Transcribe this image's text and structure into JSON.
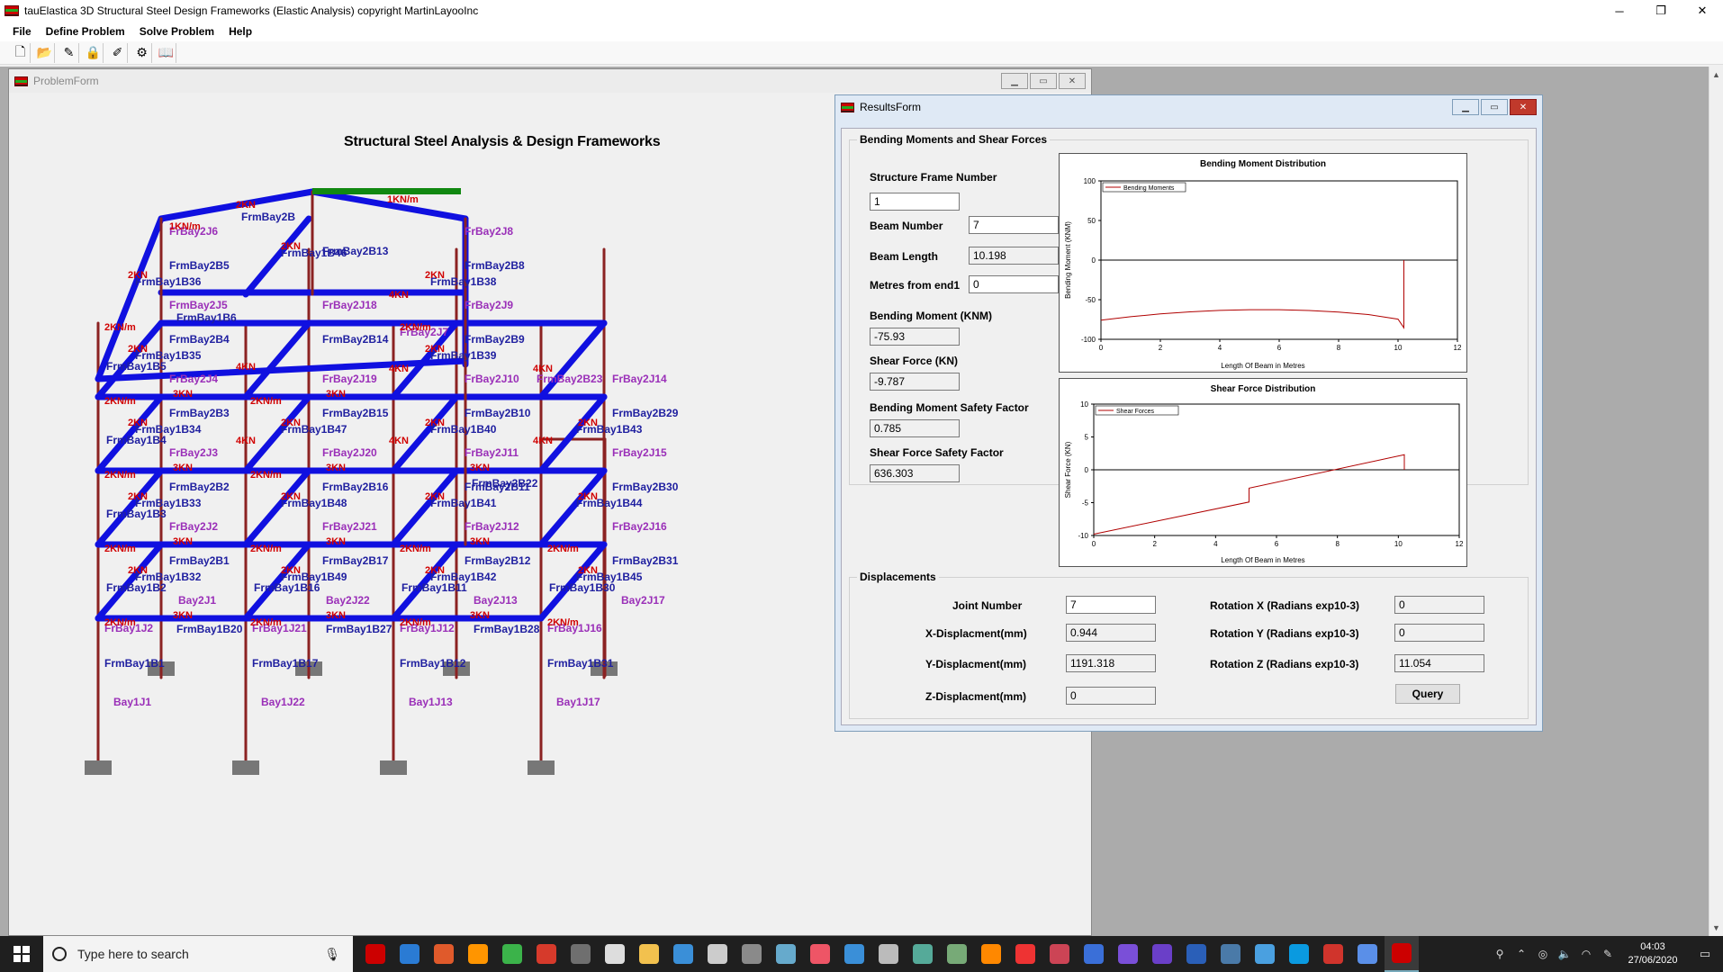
{
  "window": {
    "title": "tauElastica 3D Structural Steel Design Frameworks (Elastic Analysis) copyright MartinLayooInc",
    "minimize": "─",
    "restore": "❐",
    "close": "✕"
  },
  "menu": {
    "items": [
      "File",
      "Define Problem",
      "Solve Problem",
      "Help"
    ]
  },
  "toolbar": {
    "icons": [
      "new-file-icon",
      "open-folder-icon",
      "pencil-icon",
      "lock-icon",
      "brush-icon",
      "gear-icon",
      "book-icon"
    ],
    "glyphs": [
      "🗋",
      "📂",
      "✎",
      "🔒",
      "✐",
      "⚙",
      "📖"
    ]
  },
  "problem_form": {
    "title": "ProblemForm",
    "heading": "Structural Steel Analysis & Design Frameworks",
    "labels": {
      "frames": [
        "FrmBay1B1",
        "FrmBay1B17",
        "FrmBay1B12",
        "FrmBay1B31",
        "FrmBay2B5",
        "FrmBay2B4",
        "FrmBay2B3",
        "FrmBay2B2",
        "FrmBay2B1",
        "FrmBay2B13",
        "FrmBay2B14",
        "FrmBay2B15",
        "FrmBay2B16",
        "FrmBay2B17",
        "FrmBay2B8",
        "FrmBay2B9",
        "FrmBay2B10",
        "FrmBay2B11",
        "FrmBay2B12",
        "FrmBay2B29",
        "FrmBay2B30",
        "FrmBay2B31",
        "FrmBay1B36",
        "FrmBay1B35",
        "FrmBay1B34",
        "FrmBay1B33",
        "FrmBay1B32",
        "FrmBay1B38",
        "FrmBay1B39",
        "FrmBay1B40",
        "FrmBay1B41",
        "FrmBay1B42",
        "FrmBay1B43",
        "FrmBay1B44",
        "FrmBay1B45",
        "FrmBay1B46",
        "FrmBay1B47",
        "FrmBay1B48",
        "FrmBay1B49",
        "FrmBay1B6",
        "FrmBay1B5",
        "FrmBay1B4",
        "FrmBay1B3",
        "FrmBay1B2",
        "FrmBay1B16",
        "FrmBay1B11",
        "FrmBay1B30",
        "FrmBay1B20",
        "FrmBay1B27",
        "FrmBay1B28",
        "FrmBay2B22",
        "FrmBay2B"
      ],
      "joints": [
        "FrBay2J6",
        "FrBay2J8",
        "FrBay2J9",
        "FrBay2J18",
        "FrBay2J4",
        "FrBay2J19",
        "FrBay2J10",
        "FrmBay2B23",
        "FrBay2J14",
        "FrBay2J3",
        "FrBay2J20",
        "FrBay2J11",
        "FrBay2J15",
        "FrBay2J2",
        "FrBay2J21",
        "FrBay2J12",
        "FrBay2J16",
        "FrBay2J7",
        "FrmBay2J5",
        "FrBay1J2",
        "FrBay1J21",
        "FrBay1J12",
        "FrBay1J16",
        "Bay2J1",
        "Bay2J22",
        "Bay2J13",
        "Bay2J17",
        "Bay1J1",
        "Bay1J22",
        "Bay1J13",
        "Bay1J17"
      ],
      "loads": [
        "1KN/m",
        "2KN/m",
        "2KN",
        "3KN",
        "4KN"
      ]
    }
  },
  "results_form": {
    "title": "ResultsForm",
    "bm_group_title": "Bending Moments and Shear Forces",
    "structure_frame_number_label": "Structure Frame Number",
    "structure_frame_number": "1",
    "beam_number_label": "Beam Number",
    "beam_number": "7",
    "beam_length_label": "Beam Length",
    "beam_length": "10.198",
    "metres_from_end1_label": "Metres from end1",
    "metres_from_end1": "0",
    "bending_moment_label": "Bending Moment (KNM)",
    "bending_moment": "-75.93",
    "shear_force_label": "Shear Force (KN)",
    "shear_force": "-9.787",
    "bm_safety_label": "Bending Moment Safety Factor",
    "bm_safety": "0.785",
    "sf_safety_label": "Shear Force Safety Factor",
    "sf_safety": "636.303",
    "displacements_title": "Displacements",
    "joint_number_label": "Joint Number",
    "joint_number": "7",
    "x_disp_label": "X-Displacment(mm)",
    "x_disp": "0.944",
    "y_disp_label": "Y-Displacment(mm)",
    "y_disp": "1191.318",
    "z_disp_label": "Z-Displacment(mm)",
    "z_disp": "0",
    "rot_x_label": "Rotation X (Radians exp10-3)",
    "rot_x": "0",
    "rot_y_label": "Rotation Y (Radians exp10-3)",
    "rot_y": "0",
    "rot_z_label": "Rotation Z (Radians exp10-3)",
    "rot_z": "11.054",
    "query_button": "Query"
  },
  "chart_data": [
    {
      "type": "line",
      "title": "Bending Moment Distribution",
      "xlabel": "Length Of Beam in Metres",
      "ylabel": "Bending Moment (KNM)",
      "xlim": [
        0,
        12
      ],
      "ylim": [
        -100,
        100
      ],
      "xticks": [
        0,
        2,
        4,
        6,
        8,
        10,
        12
      ],
      "yticks": [
        100,
        50,
        0,
        -50,
        -100
      ],
      "legend": "top-left",
      "color": "#b00000",
      "series": [
        {
          "name": "Bending Moments",
          "x": [
            0,
            1,
            2,
            3,
            4,
            5,
            6,
            7,
            8,
            9,
            10,
            10.198,
            10.198
          ],
          "y": [
            -75.9,
            -71.5,
            -67.9,
            -65.3,
            -63.5,
            -62.6,
            -62.6,
            -63.6,
            -65.6,
            -68.8,
            -74.6,
            -85.5,
            0
          ]
        }
      ]
    },
    {
      "type": "line",
      "title": "Shear Force Distribution",
      "xlabel": "Length Of Beam in Metres",
      "ylabel": "Shear Force (KN)",
      "xlim": [
        0,
        12
      ],
      "ylim": [
        -10,
        10
      ],
      "xticks": [
        0,
        2,
        4,
        6,
        8,
        10,
        12
      ],
      "yticks": [
        10,
        5,
        0,
        -5,
        -10
      ],
      "legend": "top-left",
      "color": "#b00000",
      "series": [
        {
          "name": "Shear Forces",
          "x": [
            0,
            5.1,
            5.1,
            10.198,
            10.198
          ],
          "y": [
            -9.8,
            -4.9,
            -2.8,
            2.3,
            0
          ]
        }
      ]
    }
  ],
  "taskbar": {
    "search_placeholder": "Type here to search",
    "time": "04:03",
    "date": "27/06/2020",
    "app_colors": [
      "#c00",
      "#2a7bd4",
      "#e05a2b",
      "#ff9500",
      "#3bb34a",
      "#d63a2b",
      "#6f6f6f",
      "#ddd",
      "#f2c14e",
      "#3a8fd8",
      "#ccc",
      "#8a8a8a",
      "#6ac",
      "#e56",
      "#3a8fd8",
      "#bbb",
      "#5a9",
      "#7a7",
      "#f80",
      "#e33",
      "#c45",
      "#3a6fd8",
      "#7a4fd8",
      "#6a3fc8",
      "#2a5fb8",
      "#4a7aa8",
      "#4aa0e0",
      "#0a9ae0",
      "#d0342c",
      "#5a8fe8",
      "#c00"
    ]
  }
}
